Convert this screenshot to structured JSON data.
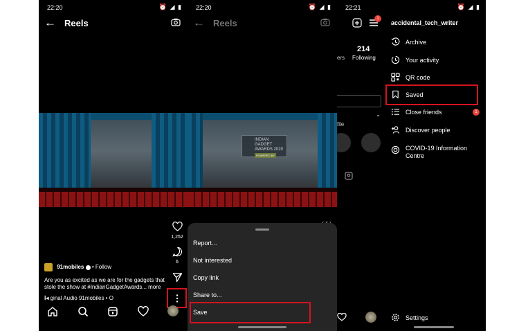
{
  "screens": {
    "reel": {
      "status_time": "22:20",
      "title": "Reels",
      "likes": "1,252",
      "comments": "6",
      "account": "91mobiles",
      "follow": "Follow",
      "caption_line1": "Are you as excited as we are for the gadgets that",
      "caption_line2": "stole the show at #IndianGadgetAwards... more",
      "audio": "ginal Audio  91mobiles • O",
      "stage_sign_line1": "INDIAN GADGET",
      "stage_sign_line2": "AWARDS 2020",
      "stage_sign_tag": "POWERED BY"
    },
    "options": {
      "status_time": "22:20",
      "title": "Reels",
      "menu": [
        {
          "label": "Report..."
        },
        {
          "label": "Not interested"
        },
        {
          "label": "Copy link"
        },
        {
          "label": "Share to..."
        },
        {
          "label": "Save"
        }
      ]
    },
    "profile": {
      "status_time": "22:21",
      "following_count": "214",
      "following_label": "Following",
      "followers_partial": "ers",
      "profile_partial": "file",
      "notification_count": "1",
      "username": "accidental_tech_writer",
      "menu": [
        {
          "label": "Archive",
          "icon": "archive-icon"
        },
        {
          "label": "Your activity",
          "icon": "activity-icon"
        },
        {
          "label": "QR code",
          "icon": "qr-code-icon"
        },
        {
          "label": "Saved",
          "icon": "bookmark-icon"
        },
        {
          "label": "Close friends",
          "icon": "close-friends-icon",
          "badge": "1"
        },
        {
          "label": "Discover people",
          "icon": "add-person-icon"
        },
        {
          "label": "COVID-19 Information",
          "label2": "Centre",
          "icon": "info-circle-icon"
        }
      ],
      "settings_label": "Settings"
    }
  },
  "colors": {
    "highlight": "#d6131f",
    "badge": "#e8453c",
    "sheet_bg": "#262626"
  }
}
